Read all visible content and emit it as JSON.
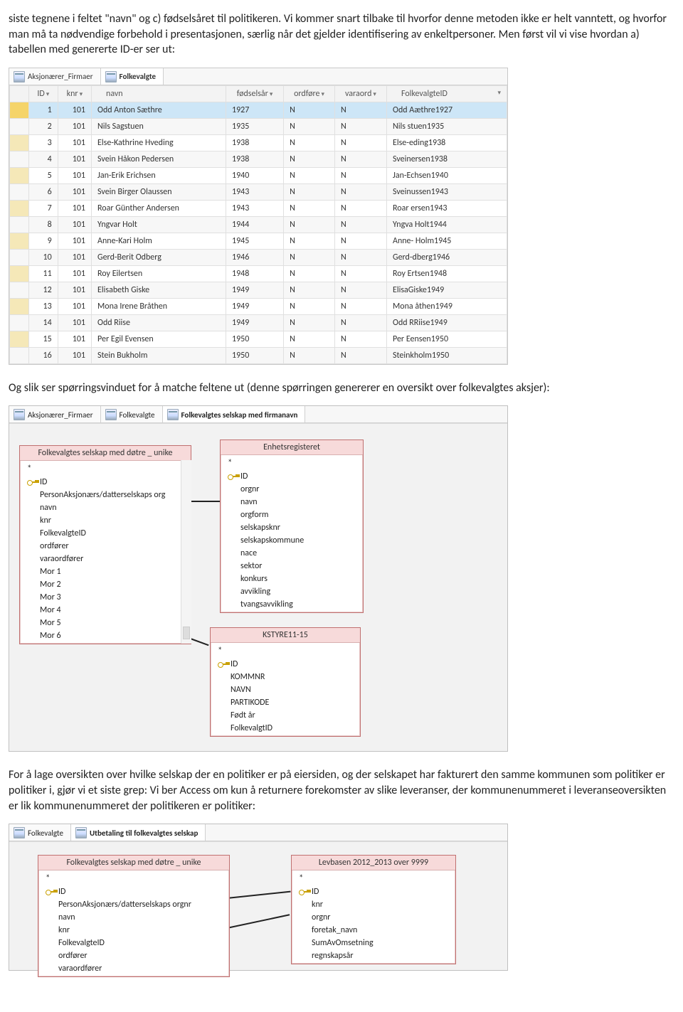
{
  "paragraphs": {
    "p1": "siste tegnene i feltet \"navn\" og c) fødselsåret til politikeren. Vi kommer snart tilbake til hvorfor denne metoden ikke er helt vanntett, og hvorfor man må ta nødvendige forbehold i presentasjonen, særlig når det gjelder identifisering av enkeltpersoner. Men først vil vi vise hvordan a) tabellen med genererte ID-er ser ut:",
    "p2": "Og slik ser spørringsvinduet for å matche feltene ut (denne spørringen genererer en oversikt over folkevalgtes aksjer):",
    "p3": "For å lage oversikten over hvilke selskap der en politiker er på eiersiden, og der selskapet har fakturert den samme kommunen som politiker er politiker i, gjør vi et siste grep: Vi ber Access om kun å returnere forekomster av slike leveranser, der kommunenummeret i leveranseoversikten er lik kommunenummeret der politikeren er politiker:"
  },
  "datasheet1": {
    "tabs": [
      "Aksjonærer_Firmaer",
      "Folkevalgte"
    ],
    "active_tab": 1,
    "columns": [
      "ID",
      "knr",
      "navn",
      "fødselsår",
      "ordføre",
      "varaord",
      "FolkevalgteID"
    ],
    "rows": [
      [
        "1",
        "101",
        "Odd Anton Sæthre",
        "1927",
        "N",
        "N",
        "Odd Aæthre1927"
      ],
      [
        "2",
        "101",
        "Nils Sagstuen",
        "1935",
        "N",
        "N",
        "Nils stuen1935"
      ],
      [
        "3",
        "101",
        "Else-Kathrine Hveding",
        "1938",
        "N",
        "N",
        "Else-eding1938"
      ],
      [
        "4",
        "101",
        "Svein Håkon Pedersen",
        "1938",
        "N",
        "N",
        "Sveinersen1938"
      ],
      [
        "5",
        "101",
        "Jan-Erik Erichsen",
        "1940",
        "N",
        "N",
        "Jan-Echsen1940"
      ],
      [
        "6",
        "101",
        "Svein Birger Olaussen",
        "1943",
        "N",
        "N",
        "Sveinussen1943"
      ],
      [
        "7",
        "101",
        "Roar Günther Andersen",
        "1943",
        "N",
        "N",
        "Roar ersen1943"
      ],
      [
        "8",
        "101",
        "Yngvar Holt",
        "1944",
        "N",
        "N",
        "Yngva Holt1944"
      ],
      [
        "9",
        "101",
        "Anne-Kari Holm",
        "1945",
        "N",
        "N",
        "Anne- Holm1945"
      ],
      [
        "10",
        "101",
        "Gerd-Berit Odberg",
        "1946",
        "N",
        "N",
        "Gerd-dberg1946"
      ],
      [
        "11",
        "101",
        "Roy Eilertsen",
        "1948",
        "N",
        "N",
        "Roy Ertsen1948"
      ],
      [
        "12",
        "101",
        "Elisabeth Giske",
        "1949",
        "N",
        "N",
        "ElisaGiske1949"
      ],
      [
        "13",
        "101",
        "Mona Irene Bråthen",
        "1949",
        "N",
        "N",
        "Mona åthen1949"
      ],
      [
        "14",
        "101",
        "Odd Riise",
        "1949",
        "N",
        "N",
        "Odd RRiise1949"
      ],
      [
        "15",
        "101",
        "Per Egil Evensen",
        "1950",
        "N",
        "N",
        "Per Eensen1950"
      ],
      [
        "16",
        "101",
        "Stein Bukholm",
        "1950",
        "N",
        "N",
        "Steinkholm1950"
      ]
    ]
  },
  "designer1": {
    "tabs": [
      "Aksjonærer_Firmaer",
      "Folkevalgte",
      "Folkevalgtes selskap med firmanavn"
    ],
    "active_tab": 2,
    "box1": {
      "title": "Folkevalgtes selskap med døtre _ unike",
      "fields_star": "*",
      "fields": [
        "ID",
        "PersonAksjonærs/datterselskaps org",
        "navn",
        "knr",
        "FolkevalgteID",
        "ordfører",
        "varaordfører",
        "Mor 1",
        "Mor 2",
        "Mor 3",
        "Mor 4",
        "Mor 5",
        "Mor 6"
      ]
    },
    "box2": {
      "title": "Enhetsregisteret",
      "fields_star": "*",
      "fields": [
        "ID",
        "orgnr",
        "navn",
        "orgform",
        "selskapsknr",
        "selskapskommune",
        "nace",
        "sektor",
        "konkurs",
        "avvikling",
        "tvangsavvikling"
      ]
    },
    "box3": {
      "title": "KSTYRE11-15",
      "fields_star": "*",
      "fields": [
        "ID",
        "KOMMNR",
        "NAVN",
        "PARTIKODE",
        "Født år",
        "FolkevalgtID"
      ]
    }
  },
  "designer2": {
    "tabs": [
      "Folkevalgte",
      "Utbetaling til folkevalgtes selskap"
    ],
    "active_tab": 1,
    "box1": {
      "title": "Folkevalgtes selskap med døtre _ unike",
      "fields_star": "*",
      "fields": [
        "ID",
        "PersonAksjonærs/datterselskaps orgnr",
        "navn",
        "knr",
        "FolkevalgteID",
        "ordfører",
        "varaordfører"
      ]
    },
    "box2": {
      "title": "Levbasen 2012_2013 over 9999",
      "fields_star": "*",
      "fields": [
        "ID",
        "knr",
        "orgnr",
        "foretak_navn",
        "SumAvOmsetning",
        "regnskapsår"
      ]
    }
  }
}
